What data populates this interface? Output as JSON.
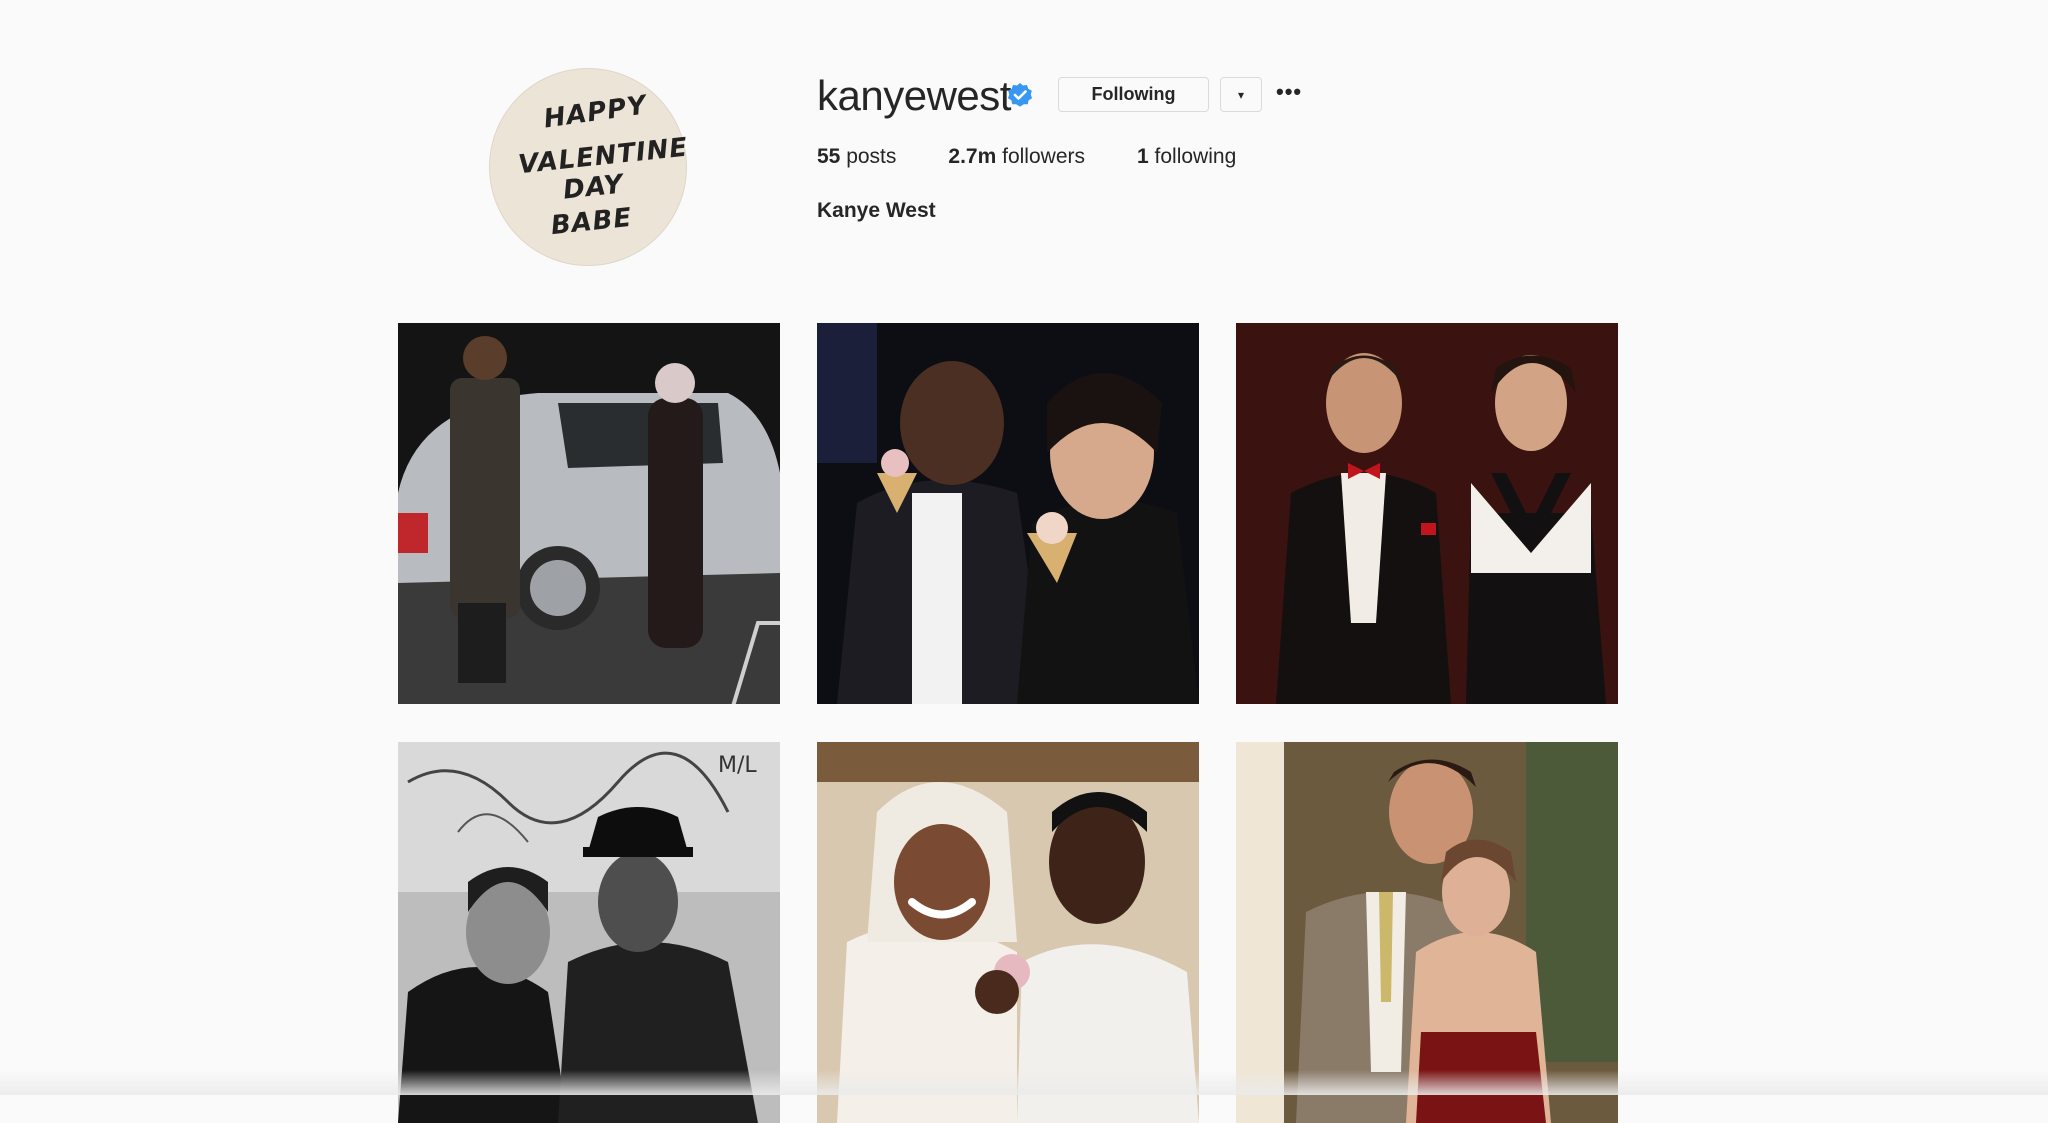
{
  "profile": {
    "avatar_text": [
      "HAPPY",
      "VALENTINES",
      "DAY",
      "BABE"
    ],
    "username": "kanyewest",
    "verified": true,
    "verified_icon": "verified-badge-icon",
    "following_label": "Following",
    "dropdown_icon": "▾",
    "more_icon": "•••",
    "stats": {
      "posts_count": "55",
      "posts_label": "posts",
      "followers_count": "2.7m",
      "followers_label": "followers",
      "following_count": "1",
      "following_label": "following"
    },
    "full_name": "Kanye West"
  },
  "colors": {
    "background": "#fafafa",
    "verified_blue": "#3897f0",
    "text": "#262626",
    "border": "#dbdbdb"
  },
  "posts": [
    {
      "name": "post-couple-by-silver-car",
      "tone": "dark"
    },
    {
      "name": "post-couple-eating-ice-cream",
      "tone": "dark"
    },
    {
      "name": "post-tuxedo-couple",
      "tone": "maroon"
    },
    {
      "name": "post-black-and-white-couple",
      "tone": "grayscale"
    },
    {
      "name": "post-wedding-couple",
      "tone": "warm"
    },
    {
      "name": "post-couple-in-suit-and-red-dress",
      "tone": "warm"
    }
  ]
}
